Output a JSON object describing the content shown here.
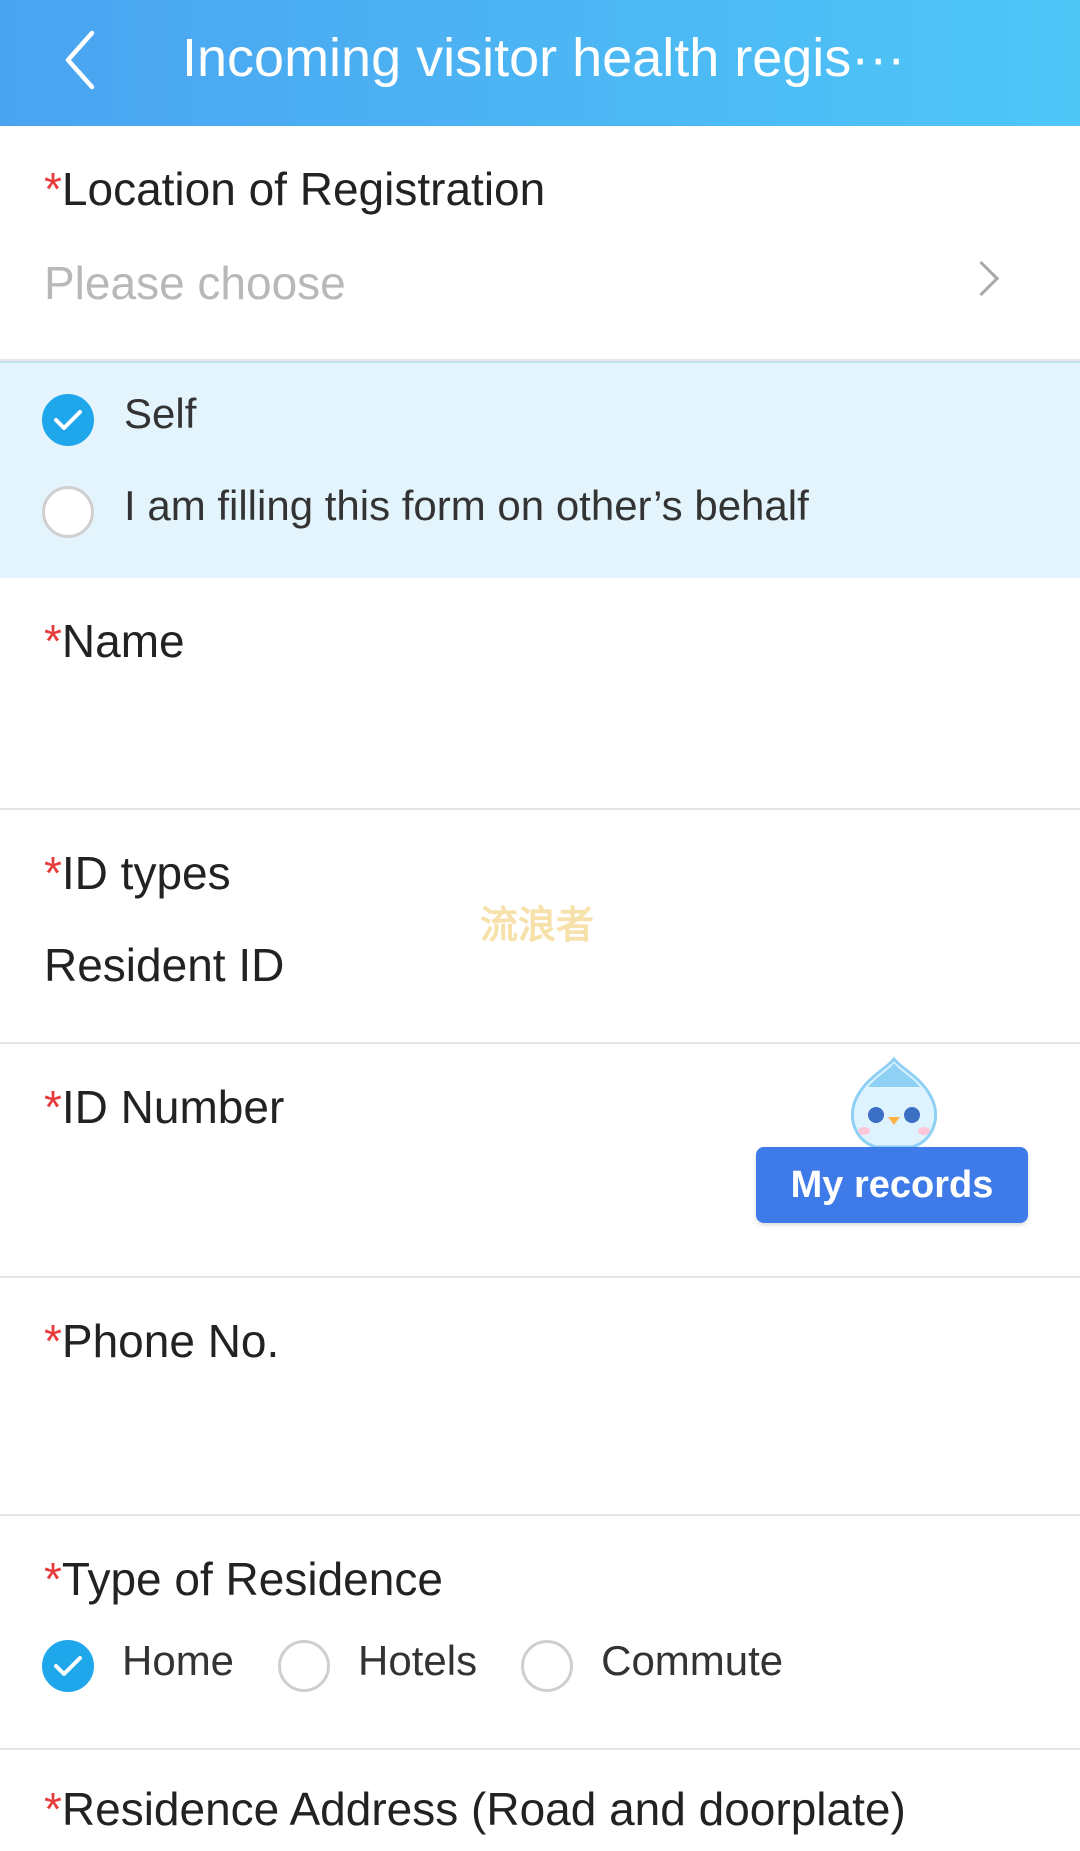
{
  "header": {
    "title": "Incoming visitor health regis···",
    "back_icon": "chevron-left-icon"
  },
  "location": {
    "required_mark": "*",
    "label": "Location of Registration",
    "placeholder": "Please choose",
    "chevron_icon": "chevron-right-icon"
  },
  "filler": {
    "options": [
      {
        "label": "Self",
        "checked": true
      },
      {
        "label": "I am filling this form on other’s behalf",
        "checked": false
      }
    ]
  },
  "name": {
    "required_mark": "*",
    "label": "Name",
    "value": ""
  },
  "id_type": {
    "required_mark": "*",
    "label": "ID types",
    "value": "Resident ID"
  },
  "id_number": {
    "required_mark": "*",
    "label": "ID Number",
    "value": ""
  },
  "watermark": "流浪者",
  "my_records": {
    "label": "My records",
    "mascot_icon": "mascot-icon"
  },
  "phone": {
    "required_mark": "*",
    "label": "Phone No.",
    "value": ""
  },
  "residence_type": {
    "required_mark": "*",
    "label": "Type of Residence",
    "options": [
      {
        "label": "Home",
        "checked": true
      },
      {
        "label": "Hotels",
        "checked": false
      },
      {
        "label": "Commute",
        "checked": false
      }
    ]
  },
  "residence_address": {
    "required_mark": "*",
    "label": "Residence Address (Road and doorplate)"
  },
  "colors": {
    "header_start": "#4aa3f0",
    "header_end": "#4ec7f7",
    "accent": "#1ea7ea",
    "required": "#e83b3b",
    "button": "#3f7be8"
  }
}
